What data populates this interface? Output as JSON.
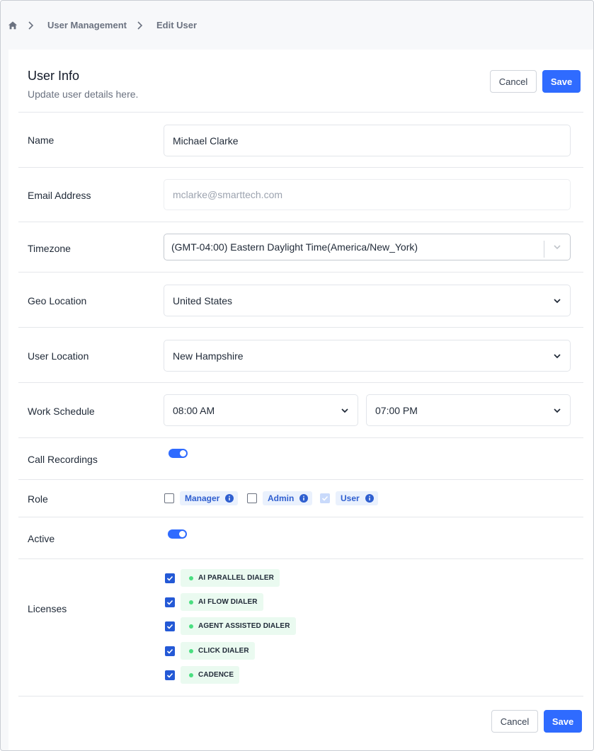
{
  "breadcrumb": {
    "home_icon": "home-icon",
    "items": [
      "User Management",
      "Edit User"
    ]
  },
  "header": {
    "title": "User Info",
    "subtitle": "Update user details here.",
    "cancel_label": "Cancel",
    "save_label": "Save"
  },
  "form": {
    "name": {
      "label": "Name",
      "value": "Michael Clarke"
    },
    "email": {
      "label": "Email Address",
      "value": "mclarke@smarttech.com"
    },
    "timezone": {
      "label": "Timezone",
      "value": "(GMT-04:00) Eastern Daylight Time(America/New_York)"
    },
    "geo": {
      "label": "Geo Location",
      "value": "United States"
    },
    "user_location": {
      "label": "User Location",
      "value": "New Hampshire"
    },
    "schedule": {
      "label": "Work Schedule",
      "start": "08:00 AM",
      "end": "07:00 PM"
    },
    "call_recordings": {
      "label": "Call Recordings",
      "on": true
    },
    "role": {
      "label": "Role",
      "options": [
        {
          "label": "Manager",
          "checked": false
        },
        {
          "label": "Admin",
          "checked": false
        },
        {
          "label": "User",
          "checked": true
        }
      ]
    },
    "active": {
      "label": "Active",
      "on": true
    },
    "licenses": {
      "label": "Licenses",
      "items": [
        "AI PARALLEL DIALER",
        "AI FLOW DIALER",
        "AGENT ASSISTED DIALER",
        "CLICK DIALER",
        "CADENCE"
      ]
    }
  },
  "footer": {
    "cancel_label": "Cancel",
    "save_label": "Save"
  },
  "colors": {
    "accent": "#2f6bff",
    "chip_blue_bg": "#eaf1fd",
    "chip_green_bg": "#eafaf0",
    "dot_green": "#4ade80"
  }
}
